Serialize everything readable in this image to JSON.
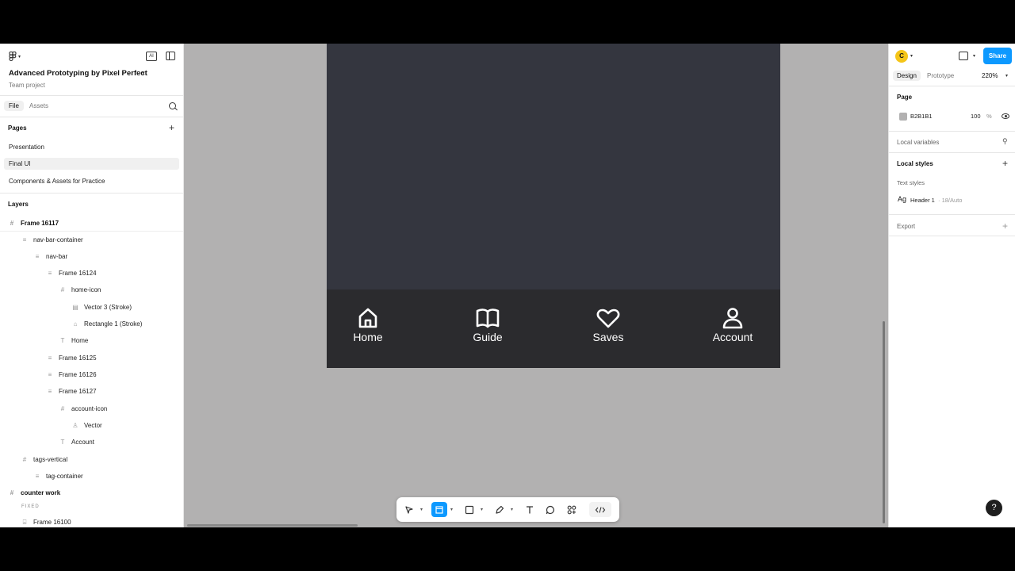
{
  "file": {
    "title": "Advanced Prototyping by Pixel Perfect",
    "subtitle": "Team project",
    "ai_label": "AI"
  },
  "left_tabs": {
    "file": "File",
    "assets": "Assets"
  },
  "pages": {
    "title": "Pages",
    "items": [
      "Presentation",
      "Final UI",
      "Components & Assets for Practice"
    ]
  },
  "layers": {
    "title": "Layers",
    "items": [
      {
        "label": "Frame 16117",
        "icon": "#"
      },
      {
        "label": "nav-bar-container",
        "icon": "≡"
      },
      {
        "label": "nav-bar",
        "icon": "≡"
      },
      {
        "label": "Frame 16124",
        "icon": "≡"
      },
      {
        "label": "home-icon",
        "icon": "#"
      },
      {
        "label": "Vector 3 (Stroke)",
        "icon": "▤"
      },
      {
        "label": "Rectangle 1 (Stroke)",
        "icon": "⌂"
      },
      {
        "label": "Home",
        "icon": "T"
      },
      {
        "label": "Frame 16125",
        "icon": "≡"
      },
      {
        "label": "Frame 16126",
        "icon": "≡"
      },
      {
        "label": "Frame 16127",
        "icon": "≡"
      },
      {
        "label": "account-icon",
        "icon": "#"
      },
      {
        "label": "Vector",
        "icon": "♙"
      },
      {
        "label": "Account",
        "icon": "T"
      },
      {
        "label": "tags-vertical",
        "icon": "#"
      },
      {
        "label": "tag-container",
        "icon": "≡"
      },
      {
        "label": "counter work",
        "icon": "#"
      },
      {
        "label": "Frame 16100",
        "icon": "⌸"
      }
    ],
    "fixed_label": "FIXED"
  },
  "navbar": {
    "items": [
      {
        "label": "Home",
        "icon": "home-icon"
      },
      {
        "label": "Guide",
        "icon": "book-icon"
      },
      {
        "label": "Saves",
        "icon": "heart-icon"
      },
      {
        "label": "Account",
        "icon": "user-icon"
      }
    ]
  },
  "right": {
    "avatar_initial": "C",
    "share": "Share",
    "tabs": {
      "design": "Design",
      "prototype": "Prototype"
    },
    "zoom": "220%",
    "page_section": "Page",
    "page_color": "B2B1B1",
    "page_opacity": "100",
    "percent": "%",
    "local_variables": "Local variables",
    "local_styles": "Local styles",
    "text_styles": "Text styles",
    "style_sample": "Ag",
    "style_name": "Header 1",
    "style_meta": "· 18/Auto",
    "export": "Export"
  },
  "help": "?"
}
